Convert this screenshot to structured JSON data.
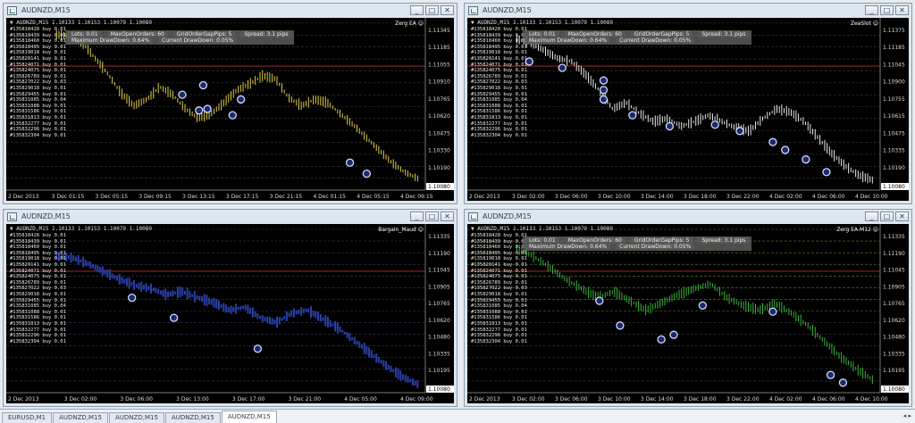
{
  "windows": [
    {
      "id": "tl",
      "title": "AUDNZD,M15",
      "ohlc": "AUDNZD,M15  1.10133 1.10153 1.10079 1.10080",
      "ea": "Zerg EA",
      "theme": "yellow",
      "bg": "#000000",
      "candle": "#e0d04a",
      "panel": true,
      "panel_rows": [
        [
          "Lots: 0.01",
          "MaxOpenOrders: 60",
          "GridOrderGapPips: 5",
          "Spread: 3.1 pips"
        ],
        [
          "Maximum DrawDown: 0.64%",
          "Current DrawDown: 0.05%"
        ]
      ],
      "prices": [
        "1.11345",
        "1.11185",
        "1.11055",
        "1.10910",
        "1.10765",
        "1.10620",
        "1.10475",
        "1.10330",
        "1.10190",
        "1.10080"
      ],
      "dates": [
        "2 Dec 2013",
        "3 Dec 01:15",
        "3 Dec 05:15",
        "3 Dec 09:15",
        "3 Dec 13:15",
        "3 Dec 17:15",
        "3 Dec 21:15",
        "4 Dec 01:15",
        "4 Dec 05:15",
        "4 Dec 09:15"
      ]
    },
    {
      "id": "tr",
      "title": "AUDNZD,M15",
      "ohlc": "AUDNZD,M15  1.10133 1.10153 1.10079 1.10080",
      "ea": "ZeaSlot",
      "theme": "white",
      "bg": "#000000",
      "candle": "#e8e8e8",
      "panel": true,
      "panel_rows": [
        [
          "Lots: 0.01",
          "MaxOpenOrders: 60",
          "GridOrderGapPips: 5",
          "Spread: 3.1 pips"
        ],
        [
          "Maximum DrawDown: 0.64%",
          "Current DrawDown: 0.05%"
        ]
      ],
      "prices": [
        "1.11375",
        "1.11185",
        "1.11045",
        "1.10900",
        "1.10755",
        "1.10615",
        "1.10475",
        "1.10335",
        "1.10190",
        "1.10080"
      ],
      "dates": [
        "2 Dec 2013",
        "3 Dec 02:00",
        "3 Dec 06:00",
        "3 Dec 10:00",
        "3 Dec 14:00",
        "3 Dec 18:00",
        "3 Dec 22:00",
        "4 Dec 02:00",
        "4 Dec 06:00",
        "4 Dec 10:00"
      ]
    },
    {
      "id": "bl",
      "title": "AUDNZD,M15",
      "ohlc": "AUDNZD,M15  1.10133 1.10153 1.10079 1.10080",
      "ea": "Bargain_Maud",
      "theme": "blue",
      "bg": "#000000",
      "candle": "#2a3fa8",
      "panel": false,
      "panel_rows": [],
      "prices": [
        "1.11335",
        "1.11190",
        "1.11045",
        "1.10905",
        "1.10765",
        "1.10620",
        "1.10480",
        "1.10335",
        "1.10195",
        "1.10080"
      ],
      "dates": [
        "2 Dec 2013",
        "3 Dec 02:00",
        "3 Dec 06:00",
        "3 Dec 13:00",
        "3 Dec 17:00",
        "3 Dec 21:00",
        "4 Dec 05:00",
        "4 Dec 09:00"
      ]
    },
    {
      "id": "br",
      "title": "AUDNZD,M15",
      "ohlc": "AUDNZD,M15  1.10133 1.10153 1.10079 1.10080",
      "ea": "Zerg EA-M12",
      "theme": "green",
      "bg": "#000000",
      "candle": "#3cb43c",
      "panel": true,
      "panel_rows": [
        [
          "Lots: 0.01",
          "MaxOpenOrders: 60",
          "GridOrderGapPips: 5",
          "Spread: 3.1 pips"
        ],
        [
          "Maximum DrawDown: 0.64%",
          "Current DrawDown: 0.05%"
        ]
      ],
      "prices": [
        "1.11335",
        "1.11190",
        "1.11045",
        "1.10905",
        "1.10765",
        "1.10620",
        "1.10480",
        "1.10335",
        "1.10195",
        "1.10080"
      ],
      "dates": [
        "2 Dec 2013",
        "3 Dec 02:00",
        "3 Dec 06:00",
        "3 Dec 10:00",
        "3 Dec 14:00",
        "3 Dec 18:00",
        "3 Dec 22:00",
        "4 Dec 02:00",
        "4 Dec 06:00",
        "4 Dec 10:00"
      ]
    }
  ],
  "orders": [
    "#135818428 buy 0.01",
    "#135818439 buy 0.01",
    "#135818460 buy 0.01",
    "#135818495 buy 0.01",
    "#135819018 buy 0.01",
    "#135820141 buy 0.01",
    "#135824071 buy 0.01",
    "#135824075 buy 0.01",
    "#135826789 buy 0.01",
    "#135827022 buy 0.03",
    "#135829018 buy 0.01",
    "#135829455 buy 0.01",
    "#135831085 buy 0.04",
    "#135831088 buy 0.01",
    "#135831586 buy 0.01",
    "#135831813 buy 0.01",
    "#135832277 buy 0.01",
    "#135832296 buy 0.01",
    "#135832304 buy 0.01"
  ],
  "tabs": [
    {
      "label": "EURUSD,M1",
      "active": false
    },
    {
      "label": "AUDNZD,M15",
      "active": false
    },
    {
      "label": "AUDNZD,M15",
      "active": false
    },
    {
      "label": "AUDNZD,M15",
      "active": false
    },
    {
      "label": "AUDNZD,M15",
      "active": true
    }
  ],
  "win_buttons": [
    "_",
    "□",
    "✕"
  ],
  "nav_arrows": "◂ ▸"
}
